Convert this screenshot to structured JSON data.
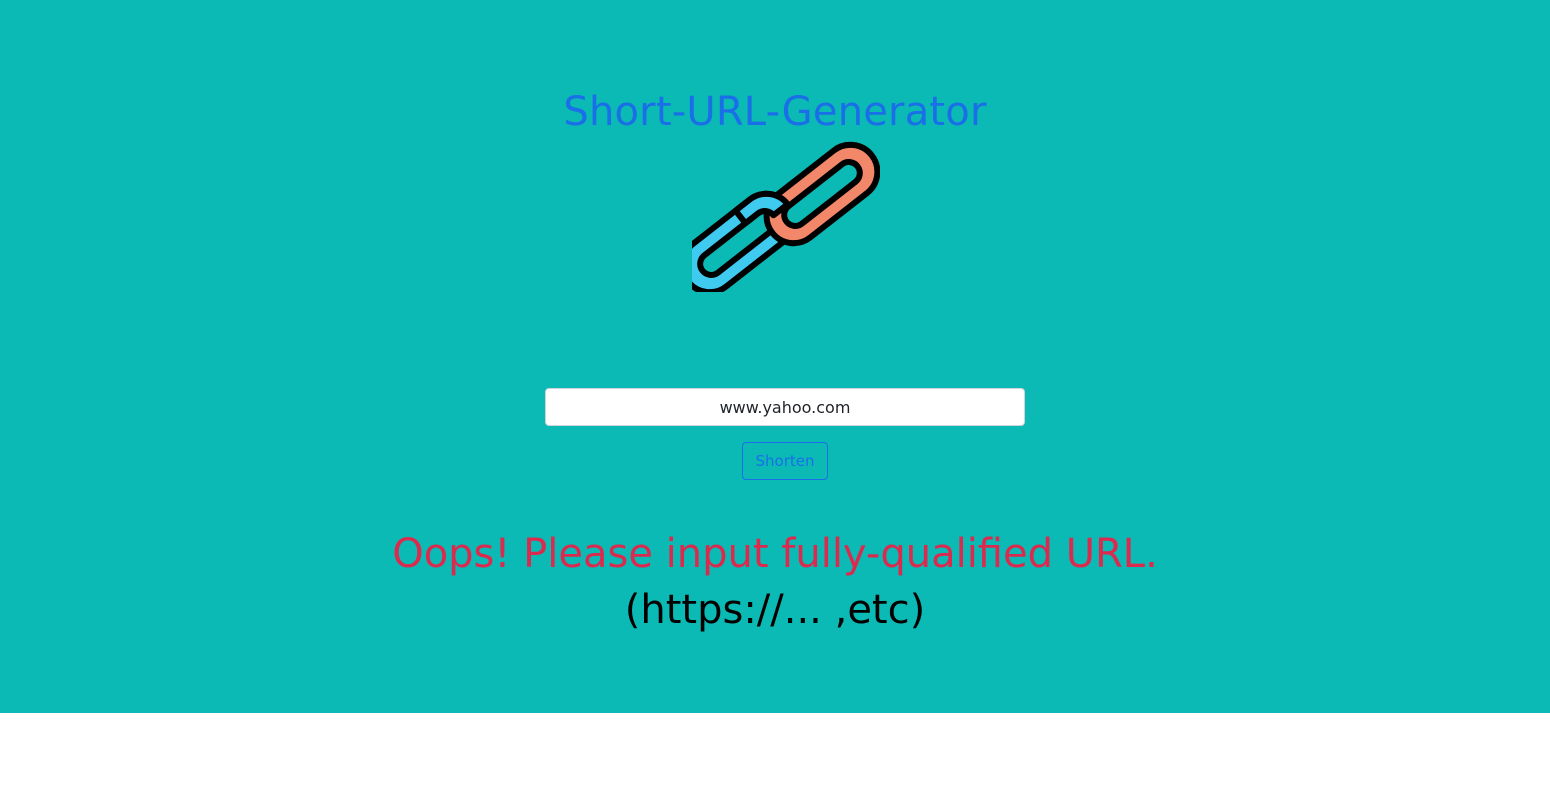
{
  "header": {
    "title": "Short-URL-Generator",
    "logo_icon": "chain-link-icon"
  },
  "form": {
    "url_value": "www.yahoo.com",
    "shorten_label": "Shorten"
  },
  "feedback": {
    "error": "Oops! Please input fully-qualified URL.",
    "hint": "(https://... ,etc)"
  },
  "colors": {
    "background": "#0bb9b5",
    "title": "#1a6fe8",
    "error": "#dc2a4e",
    "link_left": "#3fcbf0",
    "link_right": "#f2876a"
  }
}
